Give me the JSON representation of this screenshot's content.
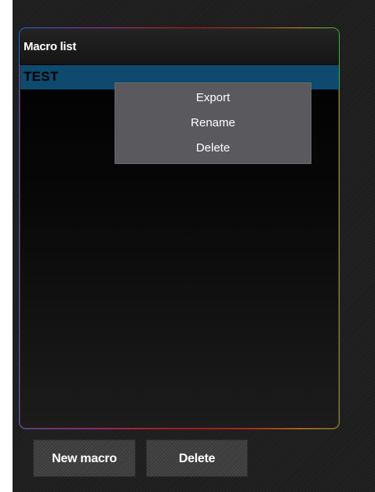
{
  "panel": {
    "title": "Macro list",
    "items": [
      {
        "label": "TEST",
        "selected": true
      }
    ]
  },
  "context_menu": {
    "items": [
      {
        "label": "Export"
      },
      {
        "label": "Rename"
      },
      {
        "label": "Delete"
      }
    ]
  },
  "buttons": {
    "new_label": "New macro",
    "delete_label": "Delete"
  },
  "colors": {
    "selection": "#0d4a6e",
    "menu_background": "#5a5a5e",
    "panel_border": "#c01c1c"
  }
}
